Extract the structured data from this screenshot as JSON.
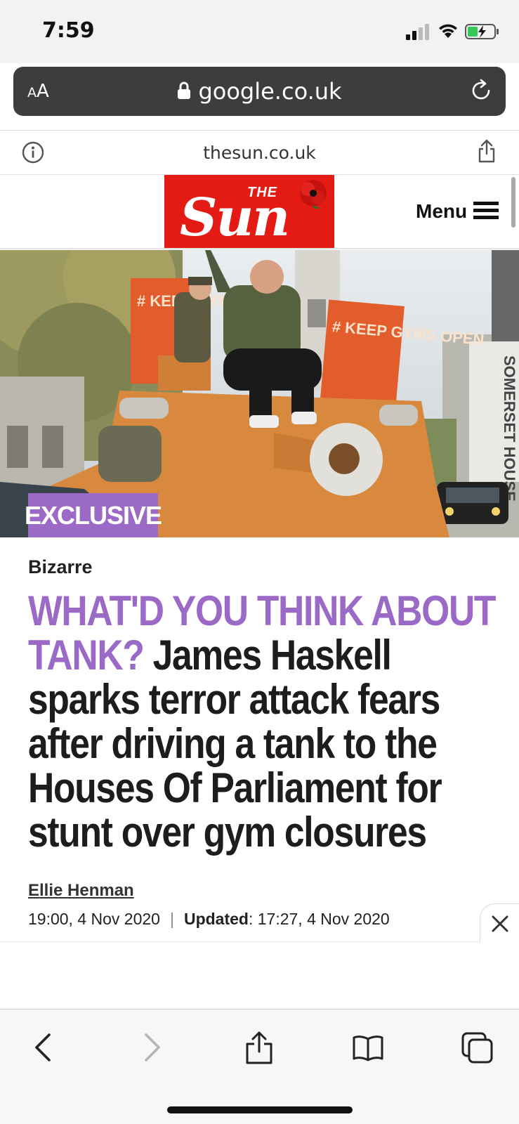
{
  "status_bar": {
    "time": "7:59"
  },
  "url_bar": {
    "text_size_label": "AA",
    "domain": "google.co.uk"
  },
  "site_bar": {
    "domain": "thesun.co.uk"
  },
  "header": {
    "logo_small": "THE",
    "logo_big": "Sun",
    "menu_label": "Menu"
  },
  "hero": {
    "badge": "EXCLUSIVE",
    "sign_text_1": "# KEEP GYMS OPEN",
    "sign_text_2": "# KEEP GYMS OPEN",
    "building_text": "SOMERSET HOUSE"
  },
  "article": {
    "kicker": "Bizarre",
    "headline_highlight": "WHAT'D YOU THINK ABOUT TANK?",
    "headline_rest": "James Haskell sparks terror attack fears after driving a tank to the Houses Of Parliament for stunt over gym closures",
    "author": "Ellie Henman",
    "published": "19:00, 4 Nov 2020",
    "updated_label": "Updated",
    "updated": ": 17:27, 4 Nov 2020"
  },
  "colors": {
    "brand_red": "#e41b14",
    "accent_purple": "#9b69c6"
  },
  "toolbar": {
    "icons": [
      "back-icon",
      "forward-icon",
      "share-icon",
      "bookmarks-icon",
      "tabs-icon"
    ]
  }
}
